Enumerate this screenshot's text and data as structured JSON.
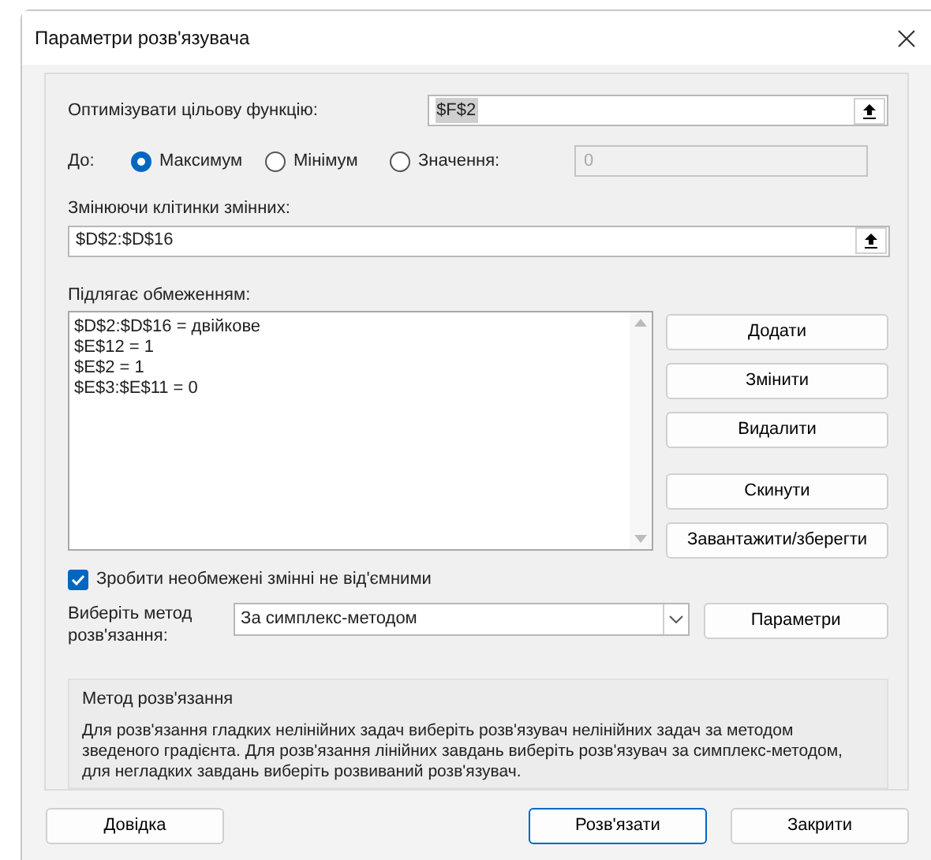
{
  "window": {
    "title": "Параметри розв'язувача"
  },
  "objective": {
    "label": "Оптимізувати цільову функцію:",
    "value": "$F$2"
  },
  "to": {
    "label": "До:",
    "options": [
      {
        "label": "Максимум",
        "selected": true
      },
      {
        "label": "Мінімум",
        "selected": false
      },
      {
        "label": "Значення:",
        "selected": false
      }
    ],
    "value_field": {
      "value": "0",
      "disabled": true
    }
  },
  "variables": {
    "label": "Змінюючи клітинки змінних:",
    "value": "$D$2:$D$16"
  },
  "constraints": {
    "label": "Підлягає обмеженням:",
    "items": [
      "$D$2:$D$16 = двійкове",
      "$E$12 = 1",
      "$E$2 = 1",
      "$E$3:$E$11 = 0"
    ],
    "buttons": [
      "Додати",
      "Змінити",
      "Видалити",
      "Скинути",
      "Завантажити/зберегти"
    ]
  },
  "nonnegative": {
    "label": "Зробити необмежені змінні не від'ємними",
    "checked": true
  },
  "method": {
    "label": "Виберіть метод розв'язання:",
    "value": "За симплекс-методом",
    "button": "Параметри"
  },
  "info": {
    "title": "Метод розв'язання",
    "text": "Для розв'язання гладких нелінійних задач виберіть розв'язувач нелінійних задач за методом зведеного градієнта. Для розв'язання лінійних завдань виберіть розв'язувач за симплекс-методом, для негладких завдань виберіть розвиваний розв'язувач."
  },
  "footer": [
    {
      "label": "Довідка",
      "default": false
    },
    {
      "label": "Розв'язати",
      "default": true
    },
    {
      "label": "Закрити",
      "default": false
    }
  ]
}
